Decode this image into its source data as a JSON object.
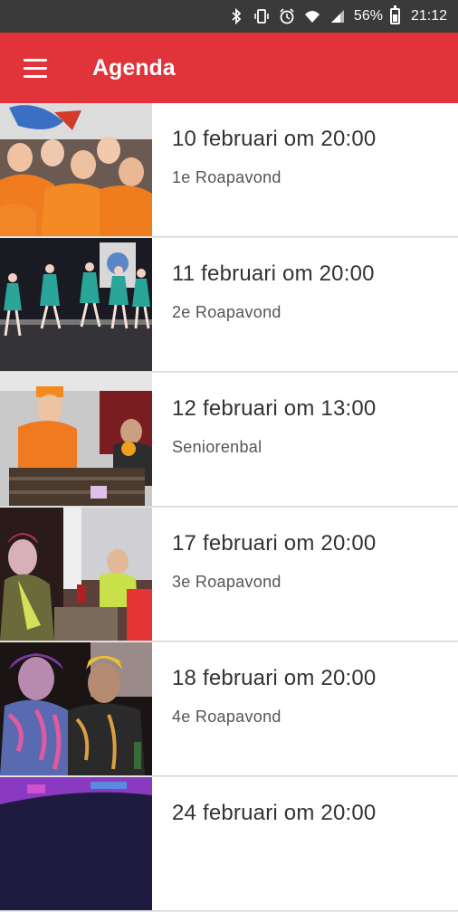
{
  "status_bar": {
    "battery": "56%",
    "time": "21:12",
    "icons": [
      "bluetooth-icon",
      "vibrate-icon",
      "alarm-icon",
      "wifi-icon",
      "signal-icon",
      "battery-icon"
    ]
  },
  "app_bar": {
    "title": "Agenda",
    "menu_icon": "hamburger-menu-icon",
    "color": "#e0333a"
  },
  "events": [
    {
      "date": "10 februari om 20:00",
      "name": "1e Roapavond"
    },
    {
      "date": "11 februari om 20:00",
      "name": "2e Roapavond"
    },
    {
      "date": "12 februari om 13:00",
      "name": "Seniorenbal"
    },
    {
      "date": "17 februari om 20:00",
      "name": "3e Roapavond"
    },
    {
      "date": "18 februari om 20:00",
      "name": "4e Roapavond"
    },
    {
      "date": "24 februari om 20:00",
      "name": ""
    }
  ]
}
